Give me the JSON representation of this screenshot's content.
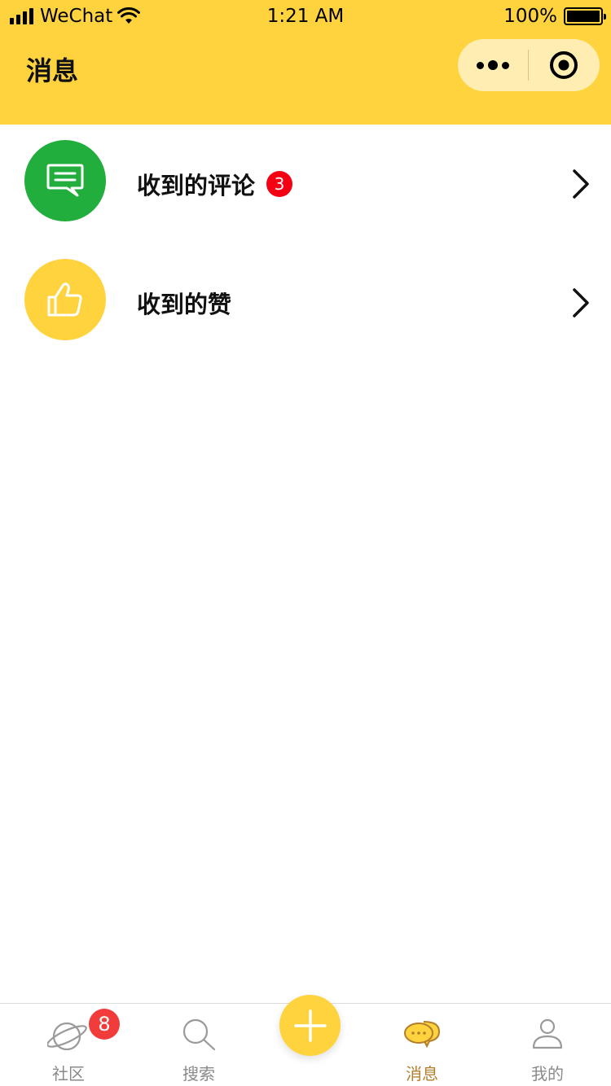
{
  "status_bar": {
    "carrier": "WeChat",
    "time": "1:21 AM",
    "battery": "100%"
  },
  "header": {
    "title": "消息"
  },
  "messages": [
    {
      "label": "收到的评论",
      "badge": "3",
      "icon": "comment-icon"
    },
    {
      "label": "收到的赞",
      "icon": "thumbs-up-icon"
    }
  ],
  "tabbar": {
    "tabs": [
      {
        "label": "社区",
        "icon": "planet-icon",
        "badge": "8"
      },
      {
        "label": "搜索",
        "icon": "search-icon"
      },
      {
        "label": "消息",
        "icon": "chat-bubble-icon",
        "active": true
      },
      {
        "label": "我的",
        "icon": "person-icon"
      }
    ],
    "fab_icon": "plus-icon"
  },
  "colors": {
    "brand_yellow": "#FFD33D",
    "green": "#22AE3C",
    "badge_red": "#F40012",
    "active_tab": "#B27E2B"
  }
}
